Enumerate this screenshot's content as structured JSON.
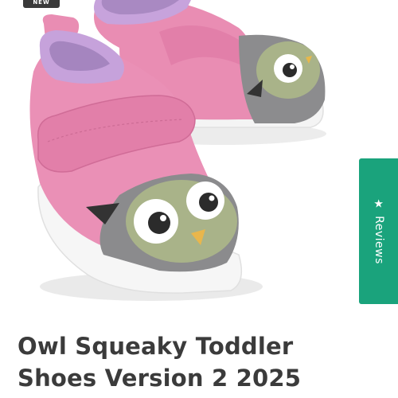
{
  "product": {
    "title": "Owl Squeaky Toddler Shoes Version 2 2025",
    "image_subject": "owl-shoes-photo"
  },
  "badge": {
    "label": "NEW"
  },
  "reviews_tab": {
    "icon": "star-icon",
    "label": "Reviews"
  },
  "colors": {
    "reviews_tab": "#1aa37c",
    "title_text": "#3b3b3b",
    "shoe_pink": "#e98db3",
    "owl_green": "#a9b389",
    "owl_gray": "#8c8c8e"
  }
}
